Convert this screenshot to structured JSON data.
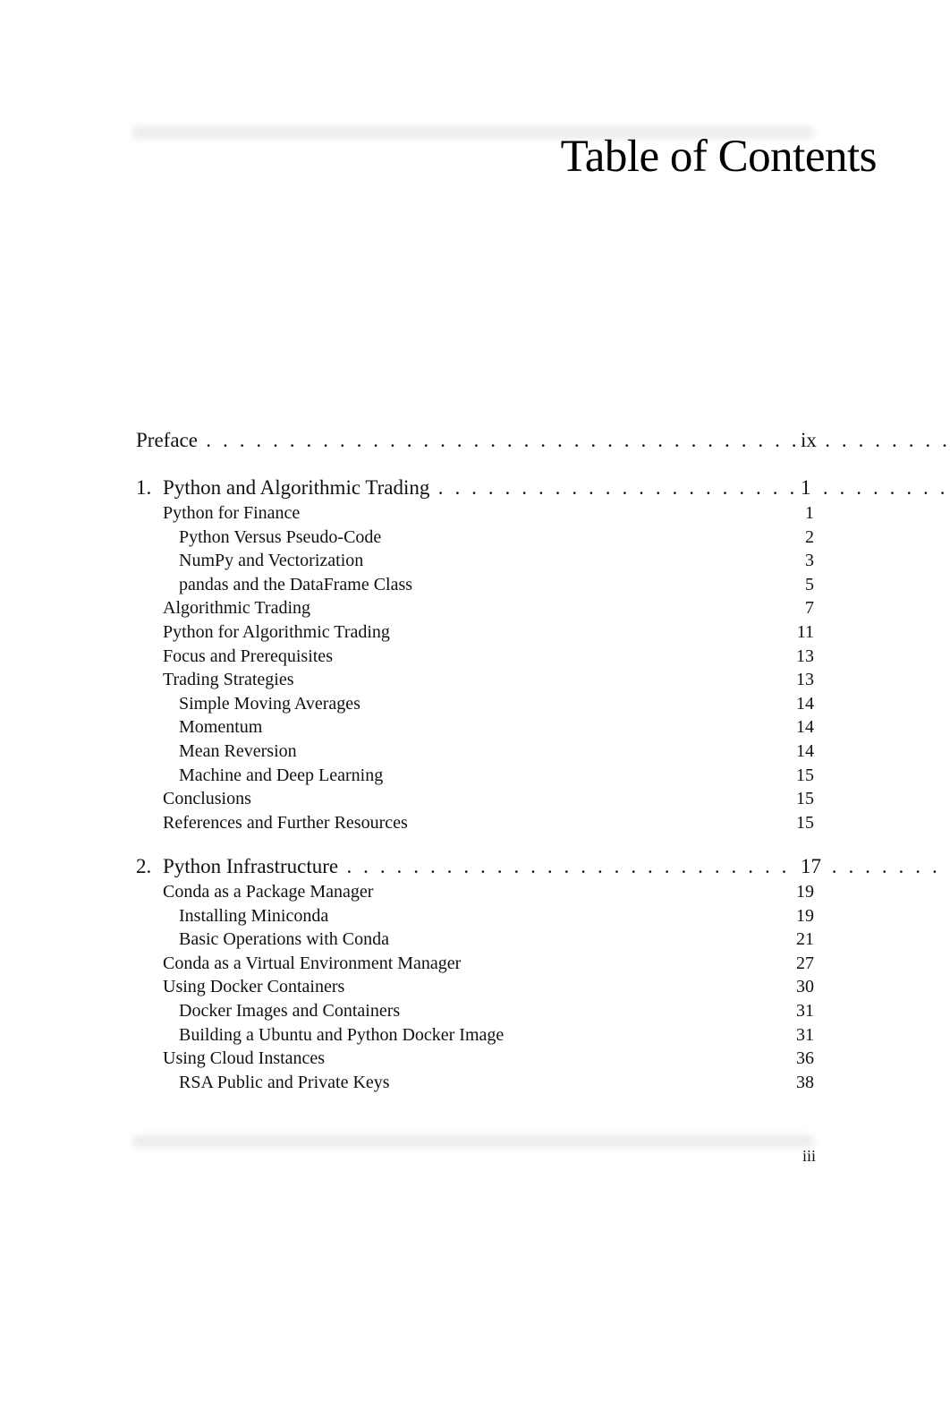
{
  "title": "Table of Contents",
  "preface": {
    "label": "Preface",
    "page": "ix"
  },
  "chapters": [
    {
      "number": "1.",
      "label": "Python and Algorithmic Trading",
      "page": "1",
      "sections": [
        {
          "label": "Python for Finance",
          "page": "1",
          "level": 1
        },
        {
          "label": "Python Versus Pseudo-Code",
          "page": "2",
          "level": 2
        },
        {
          "label": "NumPy and Vectorization",
          "page": "3",
          "level": 2
        },
        {
          "label": "pandas and the DataFrame Class",
          "page": "5",
          "level": 2
        },
        {
          "label": "Algorithmic Trading",
          "page": "7",
          "level": 1
        },
        {
          "label": "Python for Algorithmic Trading",
          "page": "11",
          "level": 1
        },
        {
          "label": "Focus and Prerequisites",
          "page": "13",
          "level": 1
        },
        {
          "label": "Trading Strategies",
          "page": "13",
          "level": 1
        },
        {
          "label": "Simple Moving Averages",
          "page": "14",
          "level": 2
        },
        {
          "label": "Momentum",
          "page": "14",
          "level": 2
        },
        {
          "label": "Mean Reversion",
          "page": "14",
          "level": 2
        },
        {
          "label": "Machine and Deep Learning",
          "page": "15",
          "level": 2
        },
        {
          "label": "Conclusions",
          "page": "15",
          "level": 1
        },
        {
          "label": "References and Further Resources",
          "page": "15",
          "level": 1
        }
      ]
    },
    {
      "number": "2.",
      "label": "Python Infrastructure",
      "page": "17",
      "sections": [
        {
          "label": "Conda as a Package Manager",
          "page": "19",
          "level": 1
        },
        {
          "label": "Installing Miniconda",
          "page": "19",
          "level": 2
        },
        {
          "label": "Basic Operations with Conda",
          "page": "21",
          "level": 2
        },
        {
          "label": "Conda as a Virtual Environment Manager",
          "page": "27",
          "level": 1
        },
        {
          "label": "Using Docker Containers",
          "page": "30",
          "level": 1
        },
        {
          "label": "Docker Images and Containers",
          "page": "31",
          "level": 2
        },
        {
          "label": "Building a Ubuntu and Python Docker Image",
          "page": "31",
          "level": 2
        },
        {
          "label": "Using Cloud Instances",
          "page": "36",
          "level": 1
        },
        {
          "label": "RSA Public and Private Keys",
          "page": "38",
          "level": 2
        }
      ]
    }
  ],
  "footer": {
    "page_number": "iii"
  }
}
